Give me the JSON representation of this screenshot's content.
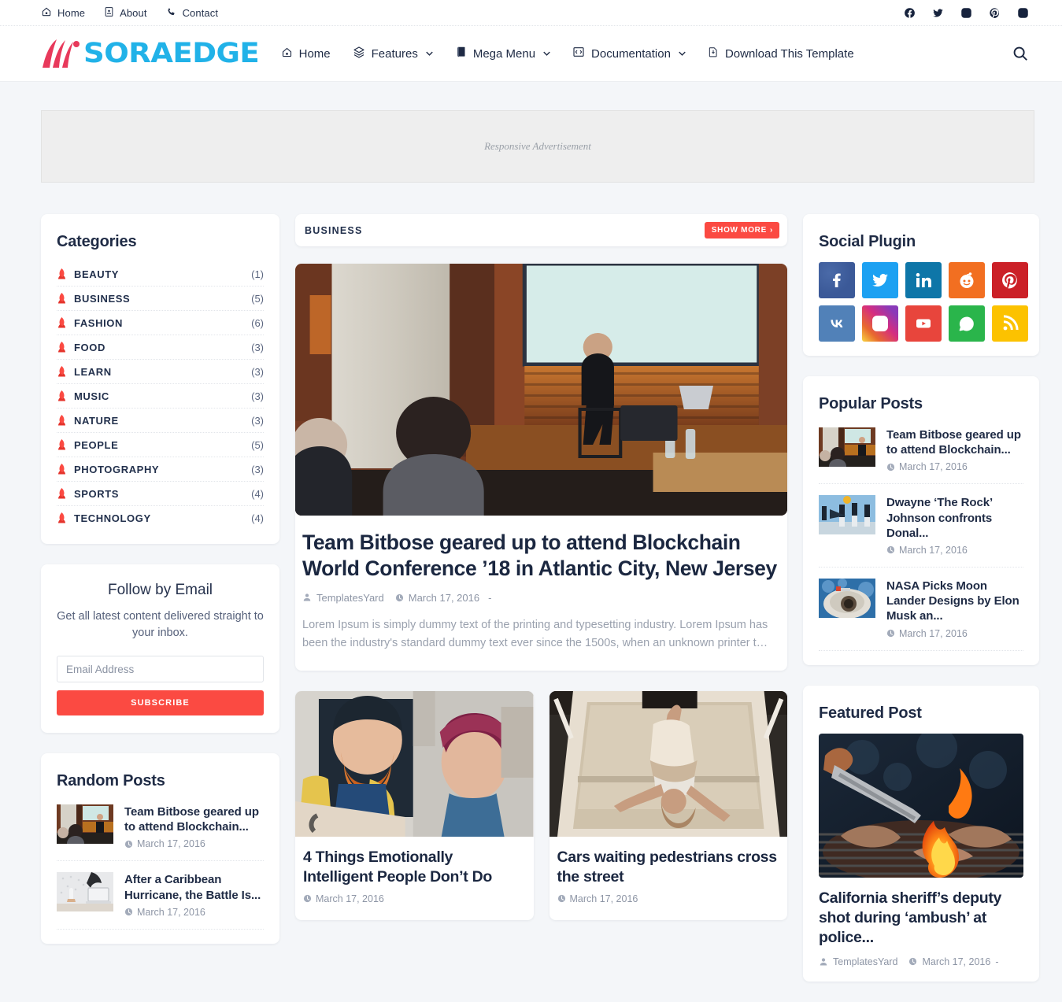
{
  "topbar": {
    "links": [
      {
        "label": "Home",
        "icon": "home-icon"
      },
      {
        "label": "About",
        "icon": "id-card-icon"
      },
      {
        "label": "Contact",
        "icon": "phone-icon"
      }
    ],
    "socials": [
      "facebook-icon",
      "twitter-icon",
      "instagram-icon",
      "pinterest-icon",
      "instagram-icon"
    ]
  },
  "header": {
    "logo_text": "SORAEDGE",
    "nav": [
      {
        "label": "Home",
        "icon": "home-icon",
        "has_caret": false
      },
      {
        "label": "Features",
        "icon": "layers-icon",
        "has_caret": true
      },
      {
        "label": "Mega Menu",
        "icon": "book-icon",
        "has_caret": true
      },
      {
        "label": "Documentation",
        "icon": "code-icon",
        "has_caret": true
      },
      {
        "label": "Download This Template",
        "icon": "download-file-icon",
        "has_caret": false
      }
    ],
    "search_icon": "search-icon"
  },
  "ad": {
    "text": "Responsive Advertisement"
  },
  "sidebar_left": {
    "categories": {
      "title": "Categories",
      "items": [
        {
          "label": "BEAUTY",
          "count": "(1)"
        },
        {
          "label": "BUSINESS",
          "count": "(5)"
        },
        {
          "label": "FASHION",
          "count": "(6)"
        },
        {
          "label": "FOOD",
          "count": "(3)"
        },
        {
          "label": "LEARN",
          "count": "(3)"
        },
        {
          "label": "MUSIC",
          "count": "(3)"
        },
        {
          "label": "NATURE",
          "count": "(3)"
        },
        {
          "label": "PEOPLE",
          "count": "(5)"
        },
        {
          "label": "PHOTOGRAPHY",
          "count": "(3)"
        },
        {
          "label": "SPORTS",
          "count": "(4)"
        },
        {
          "label": "TECHNOLOGY",
          "count": "(4)"
        }
      ]
    },
    "follow_by_email": {
      "title": "Follow by Email",
      "subtitle": "Get all latest content delivered straight to your inbox.",
      "input_placeholder": "Email Address",
      "input_value": "",
      "button_label": "SUBSCRIBE"
    },
    "random_posts": {
      "title": "Random Posts",
      "items": [
        {
          "title": "Team Bitbose geared up to attend Blockchain...",
          "date": "March 17, 2016"
        },
        {
          "title": "After a Caribbean Hurricane, the Battle Is...",
          "date": "March 17, 2016"
        }
      ]
    }
  },
  "main": {
    "section": {
      "label": "BUSINESS",
      "show_more": "SHOW MORE"
    },
    "featured_article": {
      "title": "Team Bitbose geared up to attend Blockchain World Conference ’18 in Atlantic City, New Jersey",
      "author": "TemplatesYard",
      "date": "March 17, 2016",
      "separator": "-",
      "excerpt": "Lorem Ipsum is simply dummy text of the printing and typesetting industry. Lorem Ipsum has been the industry's standard dummy text ever since the 1500s, when an unknown printer t…"
    },
    "cards": [
      {
        "title": "4 Things Emotionally Intelligent People Don’t Do",
        "date": "March 17, 2016"
      },
      {
        "title": "Cars waiting pedestrians cross the street",
        "date": "March 17, 2016"
      }
    ]
  },
  "sidebar_right": {
    "social_plugin": {
      "title": "Social Plugin",
      "tiles": [
        {
          "name": "facebook-icon",
          "color": "#3b5998"
        },
        {
          "name": "twitter-icon",
          "color": "#1da1f2"
        },
        {
          "name": "linkedin-icon",
          "color": "#0e76a8"
        },
        {
          "name": "reddit-icon",
          "color": "#f26f21"
        },
        {
          "name": "pinterest-icon",
          "color": "#cb2027"
        },
        {
          "name": "vk-icon",
          "color": "#5181b8"
        },
        {
          "name": "instagram-icon",
          "color": "#c32aa3"
        },
        {
          "name": "youtube-icon",
          "color": "#e8453c"
        },
        {
          "name": "whatsapp-icon",
          "color": "#2ab54b"
        },
        {
          "name": "rss-icon",
          "color": "#fcc200"
        }
      ]
    },
    "popular_posts": {
      "title": "Popular Posts",
      "items": [
        {
          "title": "Team Bitbose geared up to attend Blockchain...",
          "date": "March 17, 2016"
        },
        {
          "title": "Dwayne ‘The Rock’ Johnson confronts Donal...",
          "date": "March 17, 2016"
        },
        {
          "title": "NASA Picks Moon Lander Designs by Elon Musk an...",
          "date": "March 17, 2016"
        }
      ]
    },
    "featured_post": {
      "title": "Featured Post",
      "post_title": "California sheriff’s deputy shot during ‘ambush’ at police...",
      "author": "TemplatesYard",
      "date": "March 17, 2016",
      "separator": "-"
    }
  },
  "colors": {
    "accent_red": "#fb4a42",
    "brand_blue": "#21b2e8",
    "page_bg": "#f4f6f9",
    "text_dark": "#1f2b45"
  }
}
